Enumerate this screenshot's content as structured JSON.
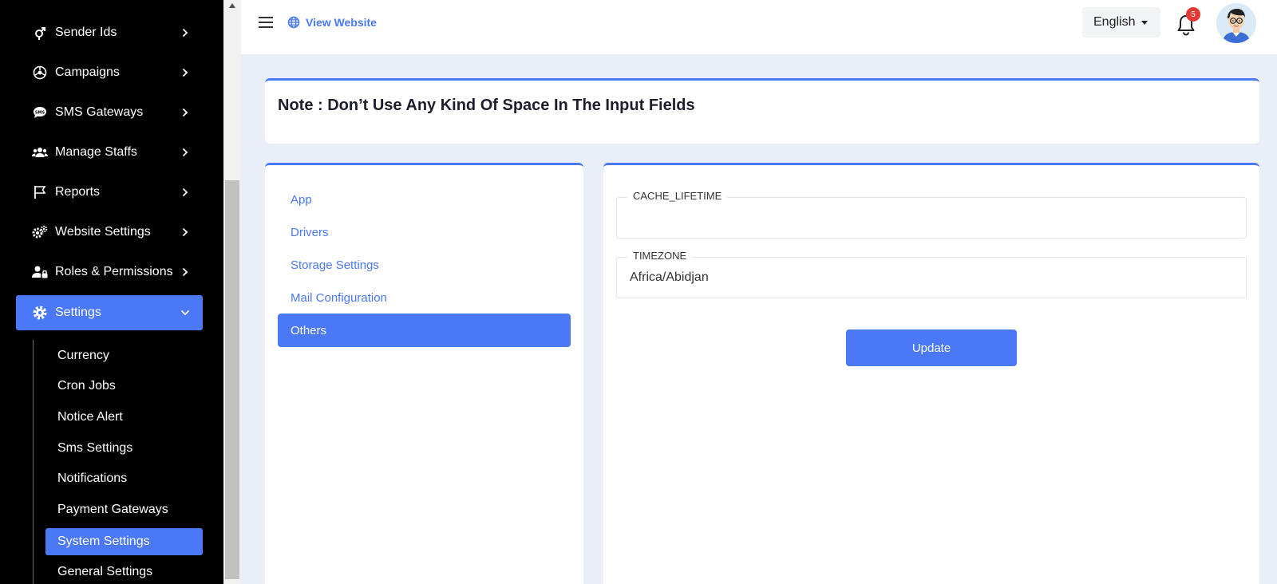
{
  "sidebar": {
    "items": [
      {
        "label": "Sender Ids",
        "icon": "gender-icon"
      },
      {
        "label": "Campaigns",
        "icon": "campaign-icon"
      },
      {
        "label": "SMS Gateways",
        "icon": "sms-chat-icon"
      },
      {
        "label": "Manage Staffs",
        "icon": "users-icon"
      },
      {
        "label": "Reports",
        "icon": "flag-icon"
      },
      {
        "label": "Website Settings",
        "icon": "gears-icon"
      },
      {
        "label": "Roles & Permissions",
        "icon": "user-lock-icon"
      },
      {
        "label": "Settings",
        "icon": "gear-icon"
      }
    ],
    "sub_items": [
      "Currency",
      "Cron Jobs",
      "Notice Alert",
      "Sms Settings",
      "Notifications",
      "Payment Gateways",
      "System Settings",
      "General Settings"
    ]
  },
  "header": {
    "view_website": "View Website",
    "language": "English",
    "notification_count": "5"
  },
  "note": "Note : Don’t Use Any Kind Of Space In The Input Fields",
  "tabs": [
    "App",
    "Drivers",
    "Storage Settings",
    "Mail Configuration",
    "Others"
  ],
  "form": {
    "cache_label": "CACHE_LIFETIME",
    "cache_value": "",
    "timezone_label": "TIMEZONE",
    "timezone_value": "Africa/Abidjan",
    "update_label": "Update"
  },
  "colors": {
    "accent": "#4a78f6",
    "sidebar_bg": "#000000",
    "page_bg": "#e9eef8",
    "badge": "#e53935"
  }
}
